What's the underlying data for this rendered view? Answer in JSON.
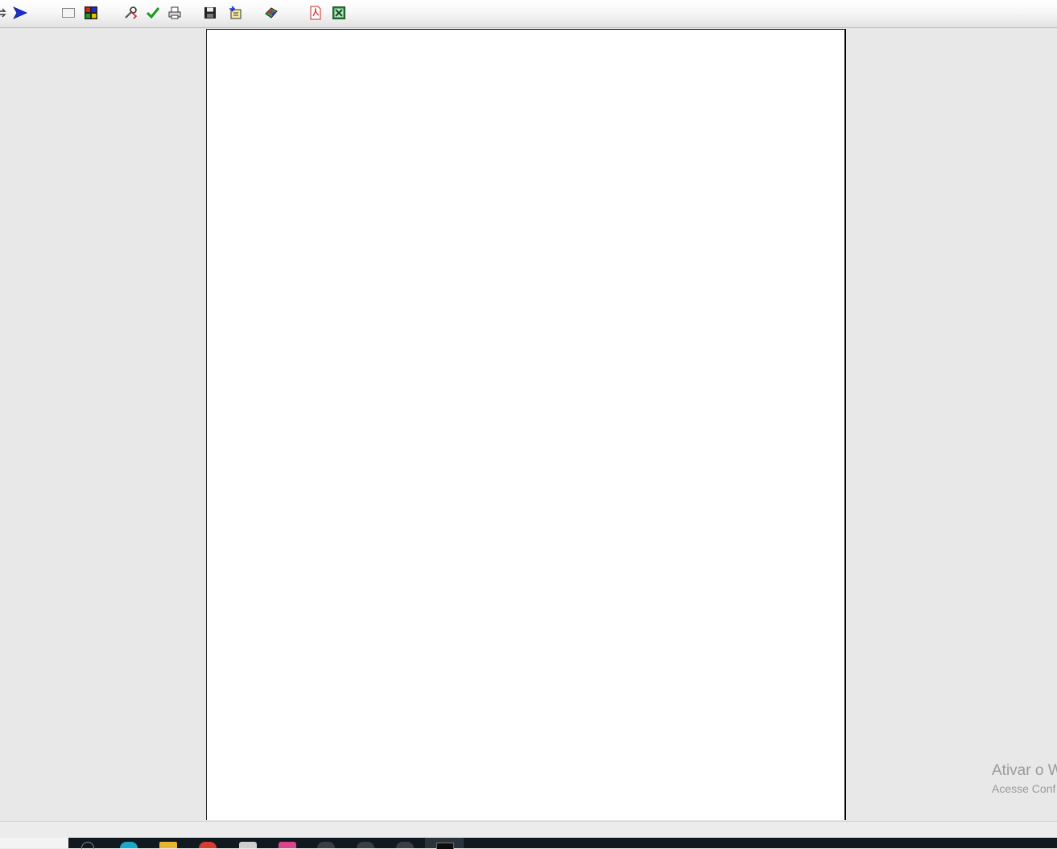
{
  "toolbar": {
    "buttons": [
      {
        "name": "open-arrow-icon",
        "label": ""
      },
      {
        "name": "send-arrow-icon",
        "label": ""
      },
      {
        "name": "blank-page-icon",
        "label": ""
      },
      {
        "name": "multi-page-icon",
        "label": ""
      },
      {
        "name": "tools-icon",
        "label": ""
      },
      {
        "name": "checkmark-icon",
        "label": ""
      },
      {
        "name": "printer-icon",
        "label": ""
      },
      {
        "name": "save-disk-icon",
        "label": ""
      },
      {
        "name": "export-icon",
        "label": ""
      },
      {
        "name": "palette-icon",
        "label": ""
      },
      {
        "name": "pdf-icon",
        "label": ""
      },
      {
        "name": "excel-icon",
        "label": ""
      }
    ]
  },
  "colors": {
    "background": "#e8e8e8",
    "page": "#ffffff",
    "taskbar": "#101820",
    "accent_blue": "#1c2fd6",
    "check_green": "#1a9a1a",
    "excel_green": "#1e7e34",
    "pdf_red": "#cc2a2a"
  },
  "watermark": {
    "title": "Ativar o W",
    "subtitle": "Acesse Conf"
  }
}
